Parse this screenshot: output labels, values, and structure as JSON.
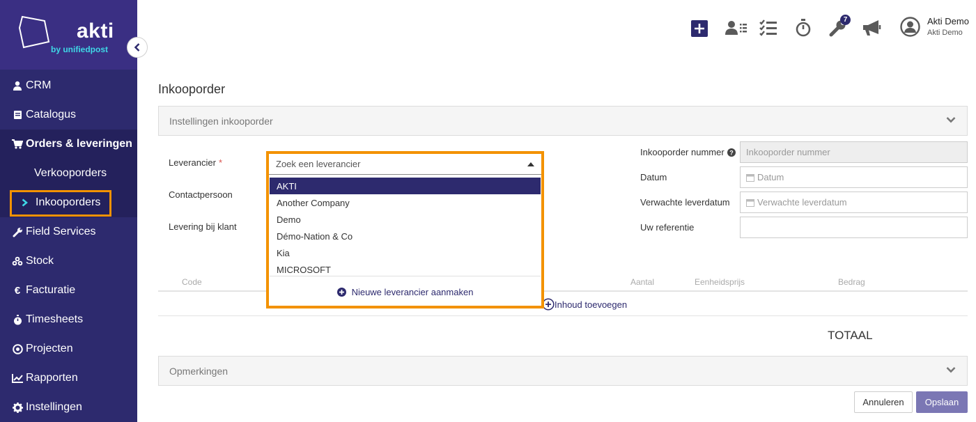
{
  "brand": {
    "name": "akti",
    "tagline": "by unifiedpost",
    "accent": "#f39200",
    "primary": "#2d2a6e",
    "sidebar_bg": "#2d2a6e"
  },
  "sidebar": {
    "items": [
      {
        "label": "CRM",
        "icon": "user-icon"
      },
      {
        "label": "Catalogus",
        "icon": "book-icon"
      },
      {
        "label": "Orders & leveringen",
        "icon": "cart-icon"
      },
      {
        "label": "Verkooporders",
        "icon": ""
      },
      {
        "label": "Inkooporders",
        "icon": "chevron-right-icon"
      },
      {
        "label": "Field Services",
        "icon": "wrench-icon"
      },
      {
        "label": "Stock",
        "icon": "cubes-icon"
      },
      {
        "label": "Facturatie",
        "icon": "euro-icon"
      },
      {
        "label": "Timesheets",
        "icon": "stopwatch-icon"
      },
      {
        "label": "Projecten",
        "icon": "target-icon"
      },
      {
        "label": "Rapporten",
        "icon": "chart-icon"
      },
      {
        "label": "Instellingen",
        "icon": "gear-icon"
      }
    ]
  },
  "header": {
    "notifications_badge": "7",
    "user_name": "Akti Demo",
    "user_company": "Akti Demo"
  },
  "page": {
    "title": "Inkooporder",
    "settings_panel": "Instellingen inkooporder",
    "remarks_panel": "Opmerkingen"
  },
  "form": {
    "supplier_label": "Leverancier",
    "required_mark": "*",
    "contact_label": "Contactpersoon",
    "delivery_label": "Levering bij klant",
    "order_number_label": "Inkooporder nummer",
    "order_number_placeholder": "Inkooporder nummer",
    "date_label": "Datum",
    "date_placeholder": "Datum",
    "expected_label": "Verwachte leverdatum",
    "expected_placeholder": "Verwachte leverdatum",
    "reference_label": "Uw referentie",
    "reference_value": ""
  },
  "dropdown": {
    "search_placeholder": "Zoek een leverancier",
    "options": [
      "AKTI",
      "Another Company",
      "Demo",
      "Démo-Nation & Co",
      "Kia",
      "MICROSOFT"
    ],
    "selected_index": 0,
    "new_supplier_label": "Nieuwe leverancier aanmaken"
  },
  "table": {
    "headers": {
      "code": "Code",
      "quantity": "Aantal",
      "unit_price": "Eenheidsprijs",
      "amount": "Bedrag"
    },
    "add_content_label": "Inhoud toevoegen",
    "total_label": "TOTAAL"
  },
  "buttons": {
    "cancel": "Annuleren",
    "save": "Opslaan"
  }
}
